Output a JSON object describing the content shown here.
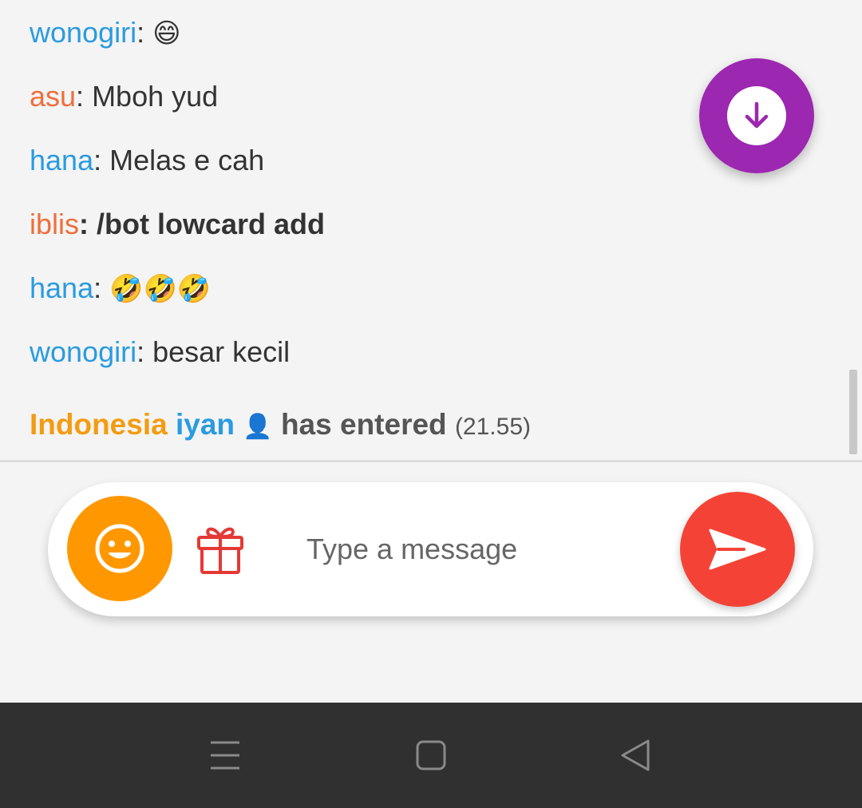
{
  "colors": {
    "user_blue": "#2a9be0",
    "user_orange": "#ee6f3b",
    "fab_purple": "#9c27b0",
    "emoji_button_orange": "#ff9800",
    "send_red": "#f44336",
    "nav_bar": "#303030"
  },
  "messages": [
    {
      "user": "wonogiri",
      "user_color": "#2a9be0",
      "separator": ": ",
      "text": "😄",
      "kind": "emoji"
    },
    {
      "user": "asu",
      "user_color": "#ee6f3b",
      "separator": ": ",
      "text": "Mboh yud",
      "kind": "text"
    },
    {
      "user": "hana",
      "user_color": "#2a9be0",
      "separator": ": ",
      "text": "Melas e cah",
      "kind": "text"
    },
    {
      "user": "iblis",
      "user_color": "#ee6f3b",
      "separator": ": ",
      "text": "/bot lowcard add",
      "kind": "bold"
    },
    {
      "user": "hana",
      "user_color": "#2a9be0",
      "separator": ": ",
      "text": "🤣🤣🤣",
      "kind": "emoji"
    },
    {
      "user": "wonogiri",
      "user_color": "#2a9be0",
      "separator": ": ",
      "text": "besar kecil",
      "kind": "text"
    }
  ],
  "system_message": {
    "country": "Indonesia",
    "user": "iyan",
    "user_icon": "👤",
    "text": "has entered",
    "time": "(21.55)"
  },
  "fab": {
    "icon": "arrow-down-icon"
  },
  "composer": {
    "placeholder": "Type a message",
    "value": "",
    "emoji_icon": "smiley-icon",
    "gift_icon": "gift-icon",
    "send_icon": "send-icon"
  },
  "navbar": {
    "icons": [
      "menu-icon",
      "home-square-icon",
      "back-triangle-icon"
    ]
  }
}
